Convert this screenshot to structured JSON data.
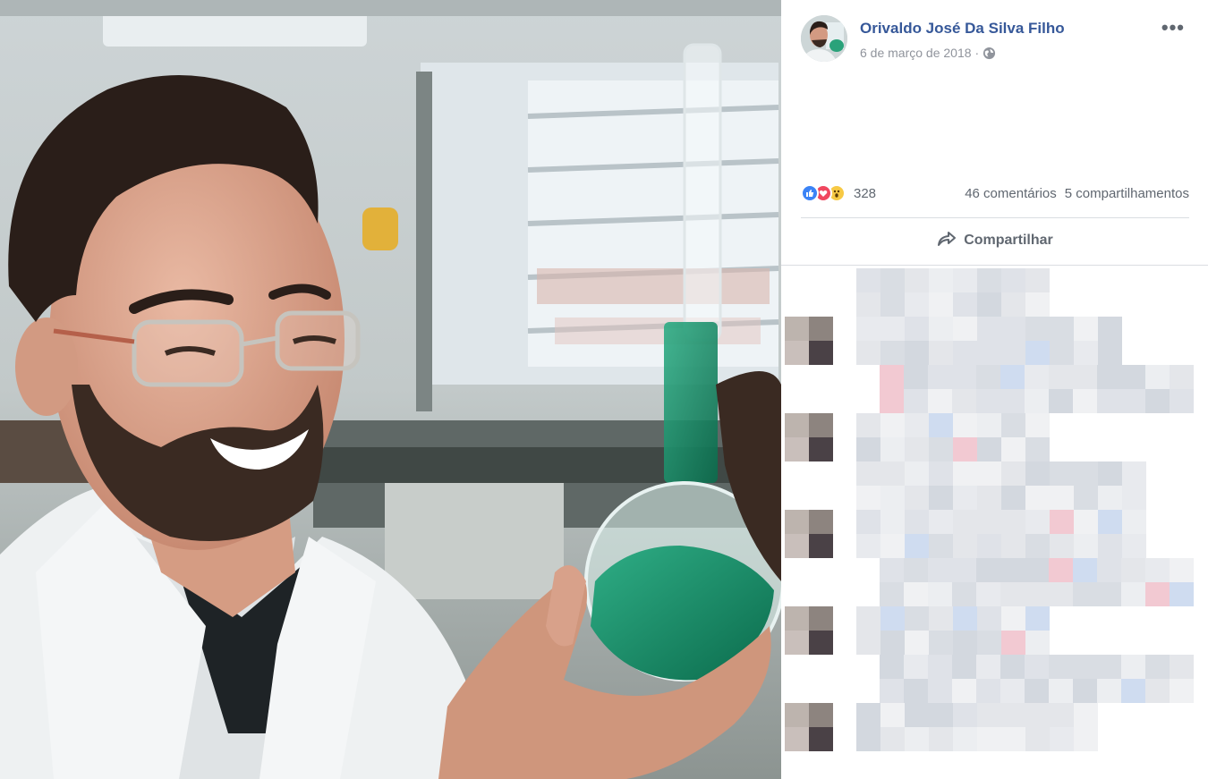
{
  "post": {
    "author": "Orivaldo José Da Silva Filho",
    "date": "6 de março de 2018",
    "date_separator": "·",
    "more_icon": "more-options-icon",
    "privacy_icon": "globe-icon",
    "reactions": {
      "icons": [
        "like-icon",
        "love-icon",
        "wow-icon"
      ],
      "count": "328"
    },
    "comments_count": "46 comentários",
    "shares_count": "5 compartilhamentos",
    "share_button": "Compartilhar"
  },
  "colors": {
    "author_link": "#365899",
    "meta_text": "#90949c",
    "action_text": "#606770",
    "like": "#3b83f6",
    "love": "#f0475f",
    "wow": "#f7c944"
  }
}
